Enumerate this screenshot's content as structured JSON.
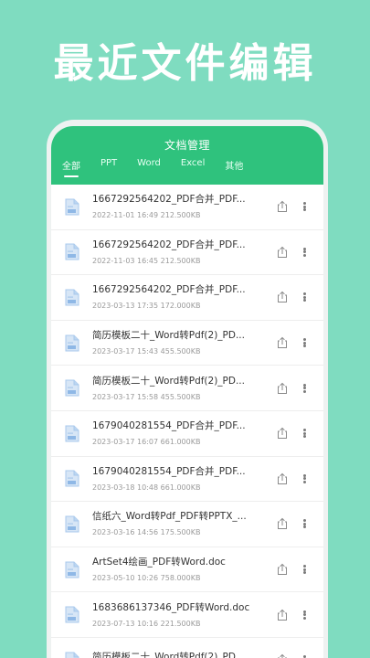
{
  "hero": {
    "title": "最近文件编辑"
  },
  "header": {
    "title": "文档管理"
  },
  "tabs": [
    {
      "label": "全部",
      "active": true
    },
    {
      "label": "PPT",
      "active": false
    },
    {
      "label": "Word",
      "active": false
    },
    {
      "label": "Excel",
      "active": false
    },
    {
      "label": "其他",
      "active": false
    }
  ],
  "icons": {
    "file": "document-icon",
    "share": "share-icon",
    "more": "more-vertical-icon"
  },
  "colors": {
    "background": "#7fdcc0",
    "accent": "#2fc27d",
    "doc_icon": "#a8c8ec"
  },
  "files": [
    {
      "name": "1667292564202_PDF合并_PDF...",
      "meta": "2022-11-01 16:49 212.500KB"
    },
    {
      "name": "1667292564202_PDF合并_PDF...",
      "meta": "2022-11-03 16:45 212.500KB"
    },
    {
      "name": "1667292564202_PDF合并_PDF...",
      "meta": "2023-03-13 17:35 172.000KB"
    },
    {
      "name": "简历模板二十_Word转Pdf(2)_PD...",
      "meta": "2023-03-17 15:43 455.500KB"
    },
    {
      "name": "简历模板二十_Word转Pdf(2)_PD...",
      "meta": "2023-03-17 15:58 455.500KB"
    },
    {
      "name": "1679040281554_PDF合并_PDF...",
      "meta": "2023-03-17 16:07 661.000KB"
    },
    {
      "name": "1679040281554_PDF合并_PDF...",
      "meta": "2023-03-18 10:48 661.000KB"
    },
    {
      "name": "信纸六_Word转Pdf_PDF转PPTX_...",
      "meta": "2023-03-16 14:56 175.500KB"
    },
    {
      "name": "ArtSet4绘画_PDF转Word.doc",
      "meta": "2023-05-10 10:26 758.000KB"
    },
    {
      "name": "1683686137346_PDF转Word.doc",
      "meta": "2023-07-13 10:16 221.500KB"
    },
    {
      "name": "简历模板二十_Word转Pdf(2)_PD...",
      "meta": ""
    }
  ]
}
